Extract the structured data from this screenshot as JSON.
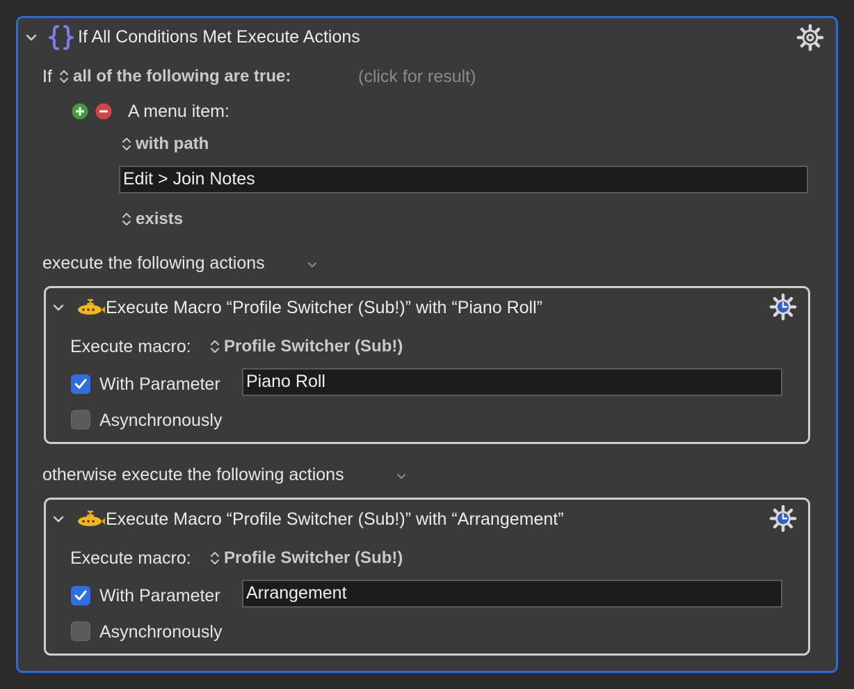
{
  "header": {
    "title": "If All Conditions Met Execute Actions",
    "icon": "curly-braces-icon",
    "accent": "#2f6bd6"
  },
  "condition": {
    "if_label": "If",
    "mode": "all of the following are true:",
    "result_hint": "(click for result)",
    "item_label": "A menu item:",
    "with_path_label": "with path",
    "path_value": "Edit > Join Notes",
    "exists_label": "exists"
  },
  "then_section": {
    "label": "execute the following actions",
    "action": {
      "title": "Execute Macro “Profile Switcher (Sub!)” with “Piano Roll”",
      "execute_macro_label": "Execute macro:",
      "macro_name": "Profile Switcher (Sub!)",
      "with_parameter_label": "With Parameter",
      "with_parameter_checked": true,
      "parameter_value": "Piano Roll",
      "async_label": "Asynchronously",
      "async_checked": false
    }
  },
  "else_section": {
    "label": "otherwise execute the following actions",
    "action": {
      "title": "Execute Macro “Profile Switcher (Sub!)” with “Arrangement”",
      "execute_macro_label": "Execute macro:",
      "macro_name": "Profile Switcher (Sub!)",
      "with_parameter_label": "With Parameter",
      "with_parameter_checked": true,
      "parameter_value": "Arrangement",
      "async_label": "Asynchronously",
      "async_checked": false
    }
  }
}
